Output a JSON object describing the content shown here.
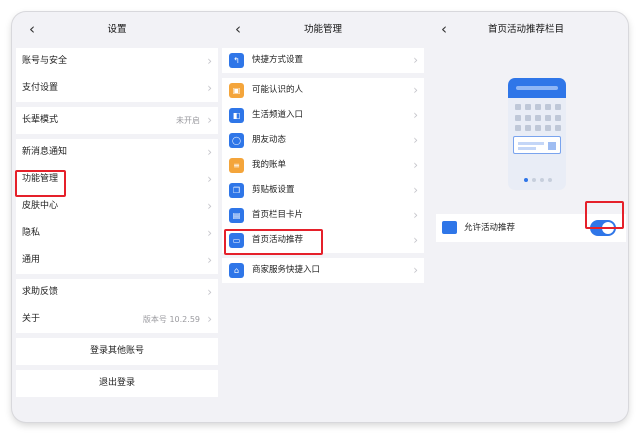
{
  "settings": {
    "title": "设置",
    "groups": [
      [
        {
          "label": "账号与安全"
        },
        {
          "label": "支付设置"
        }
      ],
      [
        {
          "label": "长辈模式",
          "value": "未开启"
        }
      ],
      [
        {
          "label": "新消息通知"
        },
        {
          "label": "功能管理"
        },
        {
          "label": "皮肤中心"
        },
        {
          "label": "隐私"
        },
        {
          "label": "通用"
        }
      ],
      [
        {
          "label": "求助反馈"
        },
        {
          "label": "关于",
          "value": "版本号 10.2.59"
        }
      ]
    ],
    "login_other": "登录其他账号",
    "logout": "退出登录"
  },
  "feature_mgmt": {
    "title": "功能管理",
    "items": [
      {
        "label": "快捷方式设置",
        "icon": "shortcut-icon"
      },
      {
        "label": "可能认识的人",
        "icon": "contacts-icon"
      },
      {
        "label": "生活频道入口",
        "icon": "life-channel-icon"
      },
      {
        "label": "朋友动态",
        "icon": "friends-feed-icon"
      },
      {
        "label": "我的账单",
        "icon": "bill-icon"
      },
      {
        "label": "剪贴板设置",
        "icon": "clipboard-icon"
      },
      {
        "label": "首页栏目卡片",
        "icon": "card-icon"
      },
      {
        "label": "首页活动推荐",
        "icon": "activity-icon"
      },
      {
        "label": "商家服务快捷入口",
        "icon": "merchant-icon"
      }
    ]
  },
  "activity": {
    "title": "首页活动推荐栏目",
    "toggle_label": "允许活动推荐",
    "toggle_on": true
  },
  "colors": {
    "accent": "#2f76e8",
    "highlight": "#e5202a",
    "icon_orange": "#f4a53b"
  }
}
